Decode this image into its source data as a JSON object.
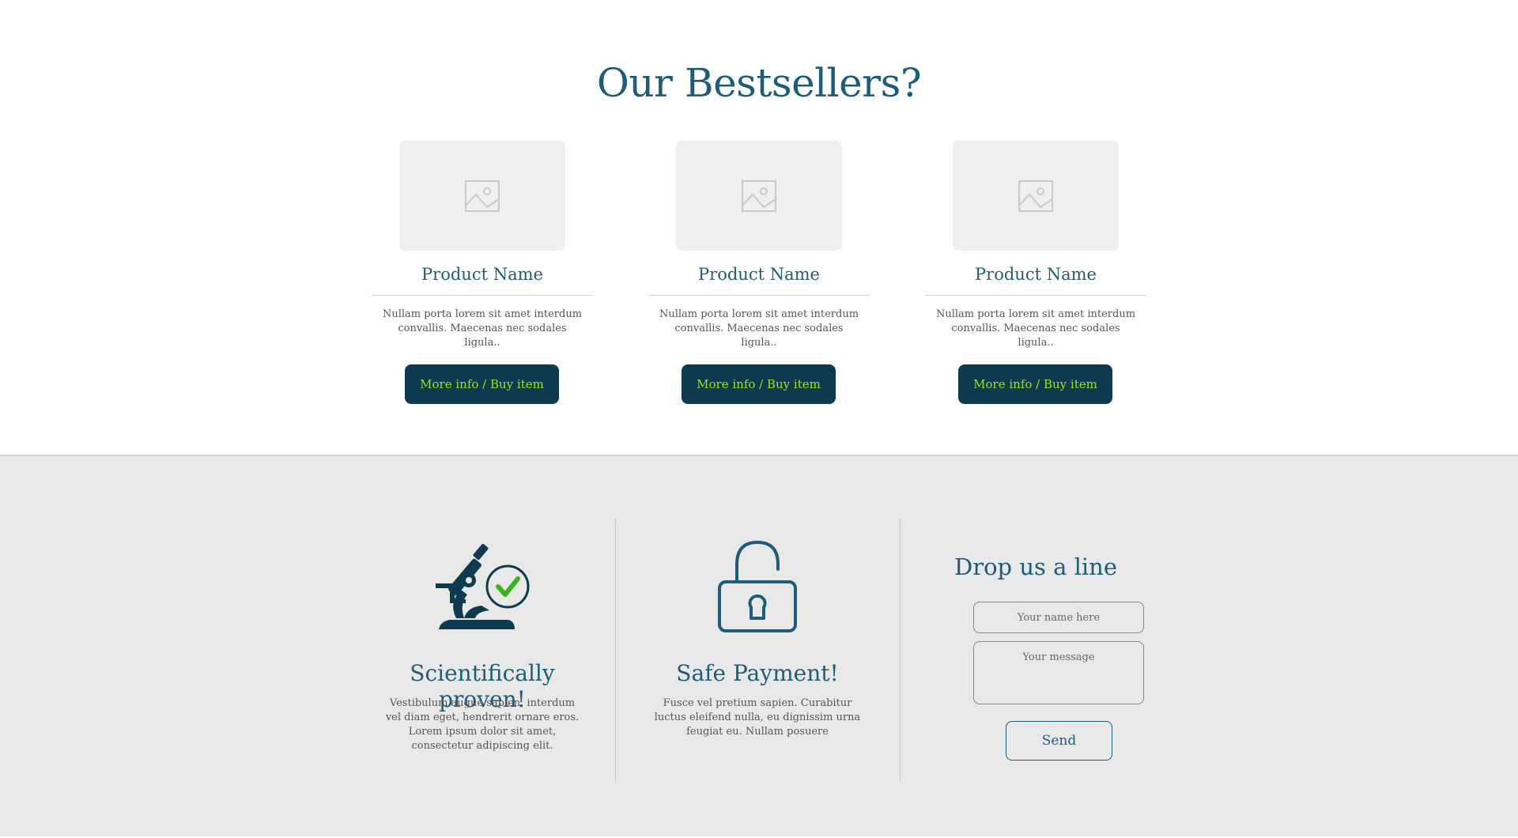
{
  "bestsellers": {
    "title": "Our Bestsellers?",
    "products": [
      {
        "name": "Product Name",
        "description": "Nullam porta lorem sit amet interdum convallis. Maecenas nec sodales ligula..",
        "button_label": "More info / Buy item",
        "image_icon": "image-placeholder-icon"
      },
      {
        "name": "Product Name",
        "description": "Nullam porta lorem sit amet interdum convallis. Maecenas nec sodales ligula..",
        "button_label": "More info / Buy item",
        "image_icon": "image-placeholder-icon"
      },
      {
        "name": "Product Name",
        "description": "Nullam porta lorem sit amet interdum convallis. Maecenas nec sodales ligula..",
        "button_label": "More info / Buy item",
        "image_icon": "image-placeholder-icon"
      }
    ]
  },
  "features": {
    "scientific": {
      "icon": "microscope-check-icon",
      "title": "Scientifically proven!",
      "text": "Vestibulum augue sapien, interdum vel diam eget, hendrerit ornare eros. Lorem ipsum dolor sit amet, consectetur adipiscing elit."
    },
    "payment": {
      "icon": "padlock-open-icon",
      "title": "Safe Payment!",
      "text": "Fusce vel pretium sapien. Curabitur luctus eleifend nulla, eu dignissim urna feugiat eu. Nullam posuere"
    },
    "contact": {
      "title": "Drop us a line",
      "name_placeholder": "Your name here",
      "message_placeholder": "Your message",
      "send_label": "Send"
    }
  },
  "colors": {
    "primary": "#1d5d78",
    "button_bg": "#0d3a4e",
    "button_text": "#9be41c",
    "check_green": "#3bb31a",
    "section_bg": "#e8e8e8"
  }
}
